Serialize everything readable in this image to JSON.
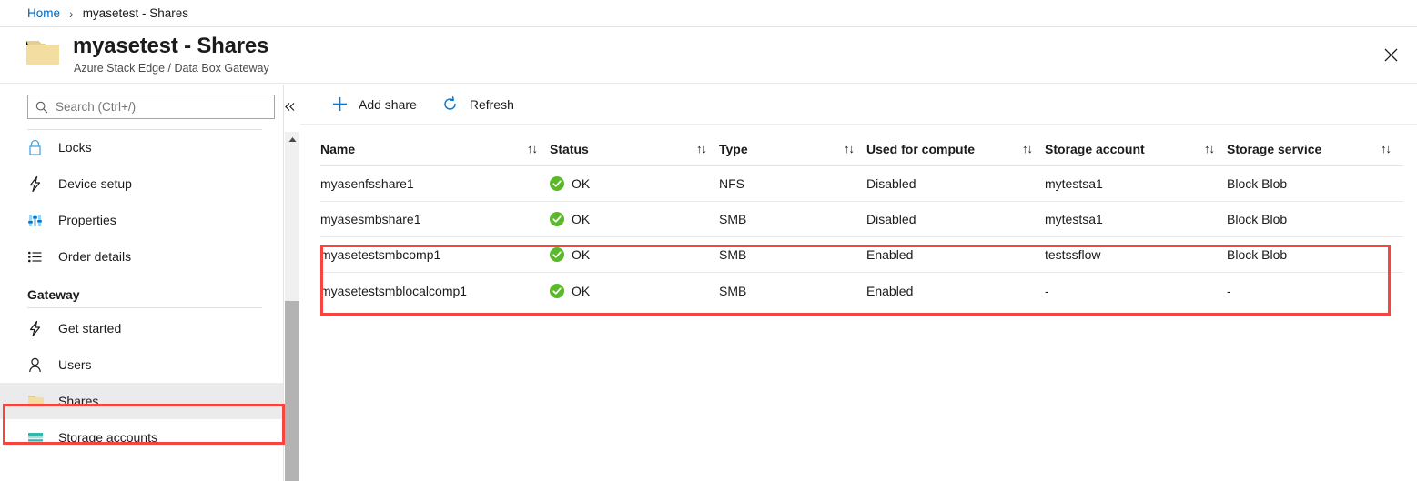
{
  "breadcrumb": {
    "home_label": "Home",
    "separator": "›",
    "current_label": "myasetest - Shares"
  },
  "header": {
    "title": "myasetest - Shares",
    "subtitle": "Azure Stack Edge / Data Box Gateway",
    "folder_icon": "folder-icon",
    "close_icon": "close-icon",
    "close_label": "✕"
  },
  "sidebar": {
    "search": {
      "placeholder": "Search (Ctrl+/)",
      "value": "",
      "icon": "search-icon"
    },
    "collapse_icon": "chevron-double-left-icon",
    "collapse_label": "«",
    "items": [
      {
        "label": "Locks",
        "icon": "lock-icon",
        "selected": false
      },
      {
        "label": "Device setup",
        "icon": "lightning-bolt-icon",
        "selected": false
      },
      {
        "label": "Properties",
        "icon": "sliders-icon",
        "selected": false
      },
      {
        "label": "Order details",
        "icon": "list-icon",
        "selected": false
      }
    ],
    "section_label": "Gateway",
    "gateway_items": [
      {
        "label": "Get started",
        "icon": "lightning-bolt-icon",
        "selected": false
      },
      {
        "label": "Users",
        "icon": "person-icon",
        "selected": false
      },
      {
        "label": "Shares",
        "icon": "folder-icon",
        "selected": true
      },
      {
        "label": "Storage accounts",
        "icon": "storage-account-icon",
        "selected": false
      }
    ],
    "scrollbar": {
      "up_arrow_icon": "scroll-up-arrow-icon"
    }
  },
  "toolbar": {
    "buttons": [
      {
        "label": "Add share",
        "icon": "plus-icon"
      },
      {
        "label": "Refresh",
        "icon": "refresh-icon"
      }
    ]
  },
  "table": {
    "sort_icon": "sort-ascending-descending-icon",
    "sort_glyph": "↑↓",
    "columns": [
      {
        "key": "name",
        "label": "Name"
      },
      {
        "key": "status",
        "label": "Status"
      },
      {
        "key": "type",
        "label": "Type"
      },
      {
        "key": "compute",
        "label": "Used for compute"
      },
      {
        "key": "account",
        "label": "Storage account"
      },
      {
        "key": "service",
        "label": "Storage service"
      }
    ],
    "rows": [
      {
        "name": "myasenfsshare1",
        "status": "OK",
        "status_icon": "check-circle-icon",
        "type": "NFS",
        "compute": "Disabled",
        "account": "mytestsa1",
        "service": "Block Blob"
      },
      {
        "name": "myasesmbshare1",
        "status": "OK",
        "status_icon": "check-circle-icon",
        "type": "SMB",
        "compute": "Disabled",
        "account": "mytestsa1",
        "service": "Block Blob"
      },
      {
        "name": "myasetestsmbcomp1",
        "status": "OK",
        "status_icon": "check-circle-icon",
        "type": "SMB",
        "compute": "Enabled",
        "account": "testssflow",
        "service": "Block Blob"
      },
      {
        "name": "myasetestsmblocalcomp1",
        "status": "OK",
        "status_icon": "check-circle-icon",
        "type": "SMB",
        "compute": "Enabled",
        "account": "-",
        "service": "-"
      }
    ]
  },
  "colors": {
    "accent_blue": "#0078d4",
    "link_blue": "#0067b8",
    "status_green": "#5cb82b",
    "highlight_red": "#f8443e",
    "folder_yellow": "#f4dda0",
    "teal": "#2fb3b0"
  }
}
